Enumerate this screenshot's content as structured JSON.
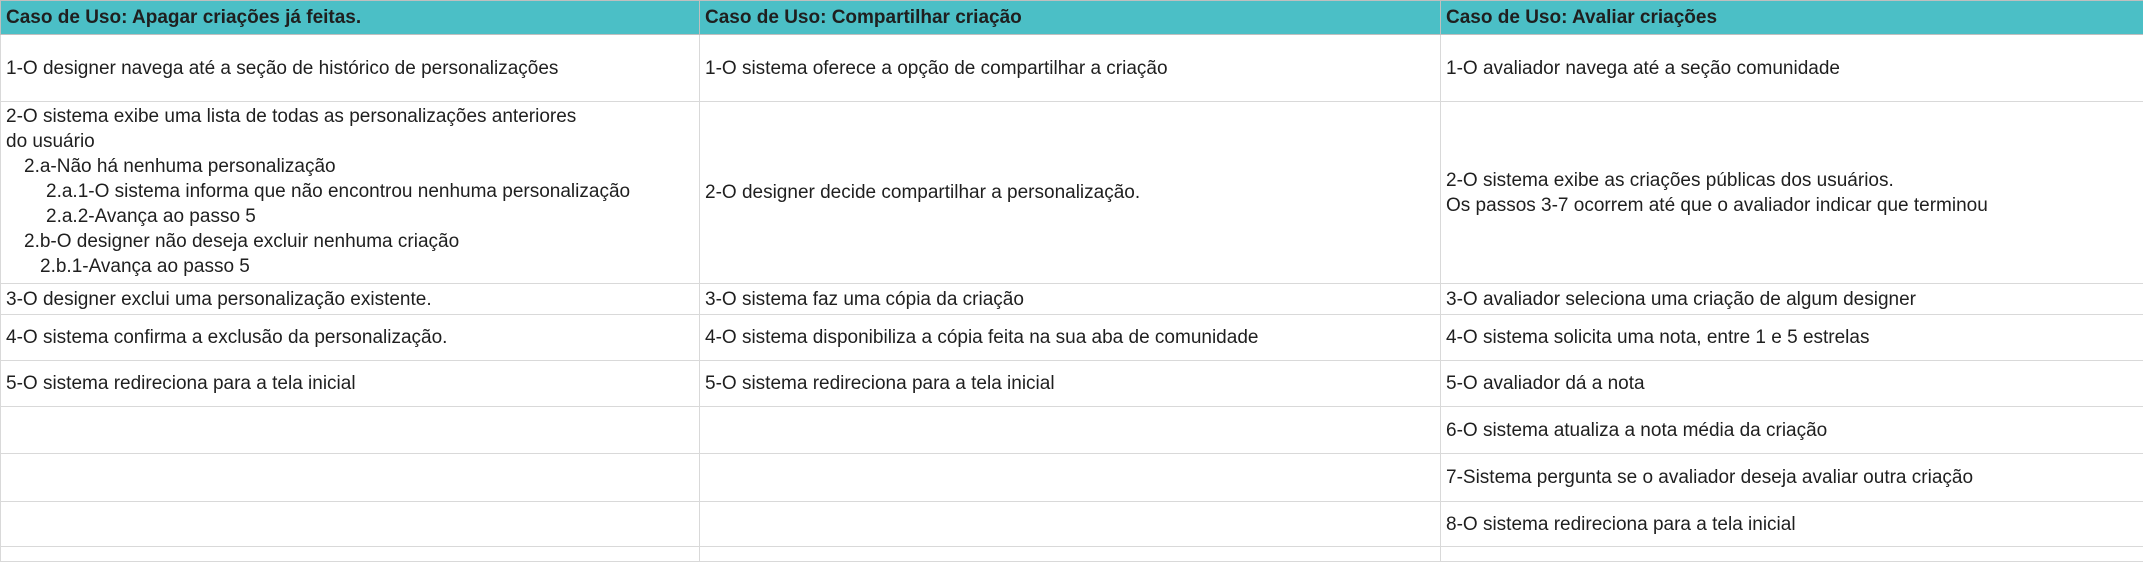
{
  "headers": [
    "Caso de Uso: Apagar criações já feitas.",
    "Caso de Uso: Compartilhar criação",
    "Caso de Uso: Avaliar criações"
  ],
  "col1": {
    "r1": "1-O designer navega até a seção de histórico de personalizações",
    "r2": [
      "2-O sistema exibe uma lista de todas as personalizações anteriores",
      "do usuário",
      "2.a-Não há nenhuma personalização",
      "2.a.1-O sistema informa que não encontrou nenhuma personalização",
      "2.a.2-Avança ao passo 5",
      "2.b-O designer não deseja excluir nenhuma criação",
      "2.b.1-Avança ao passo 5"
    ],
    "r3": "3-O designer exclui uma personalização existente.",
    "r4": "4-O sistema confirma a exclusão da personalização.",
    "r5": "5-O sistema redireciona para a tela inicial"
  },
  "col2": {
    "r1": "1-O sistema oferece a opção de compartilhar a criação",
    "r2": "2-O designer decide compartilhar a personalização.",
    "r3": "3-O sistema faz uma cópia da criação",
    "r4": "4-O sistema disponibiliza a cópia feita na sua aba de comunidade",
    "r5": "5-O sistema redireciona para a tela inicial"
  },
  "col3": {
    "r1": "1-O avaliador navega até a seção comunidade",
    "r2": [
      "2-O sistema exibe as criações públicas dos usuários.",
      "Os passos 3-7 ocorrem até que o avaliador indicar que terminou"
    ],
    "r3": "3-O avaliador seleciona uma criação de algum designer",
    "r4": "4-O sistema solicita uma nota, entre 1 e 5 estrelas",
    "r5": "5-O avaliador dá a nota",
    "r6": "6-O sistema atualiza a nota média da criação",
    "r7": "7-Sistema pergunta se o avaliador deseja avaliar outra criação",
    "r8": "8-O sistema redireciona para a tela inicial"
  },
  "colors": {
    "header_bg": "#4bbfc6",
    "grid": "#d9d9d9"
  }
}
